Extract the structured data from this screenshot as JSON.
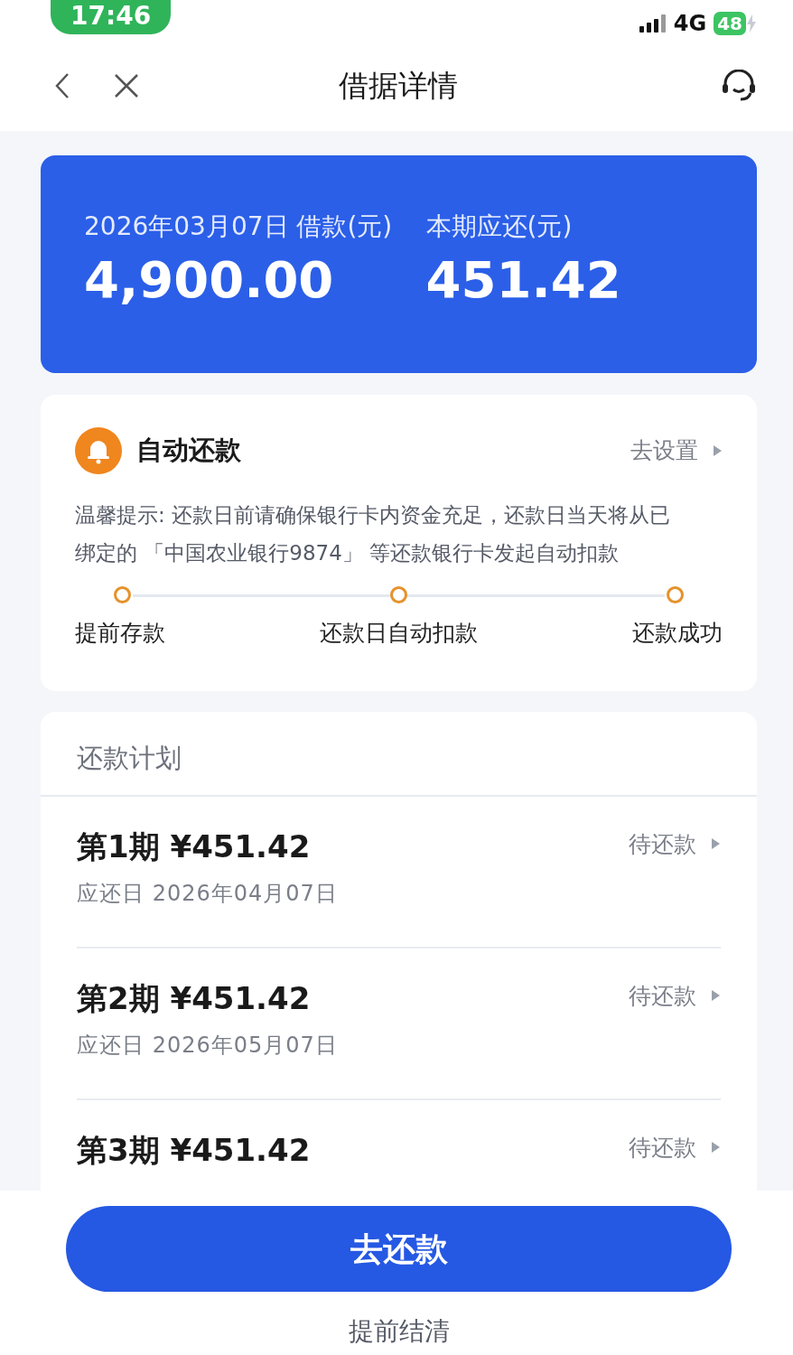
{
  "status_bar": {
    "time": "17:46",
    "network": "4G",
    "battery": "48"
  },
  "header": {
    "title": "借据详情"
  },
  "summary": {
    "loan_label": "2026年03月07日 借款(元)",
    "loan_amount": "4,900.00",
    "due_label": "本期应还(元)",
    "due_amount": "451.42"
  },
  "auto_repay": {
    "title": "自动还款",
    "action": "去设置",
    "notice": "温馨提示: 还款日前请确保银行卡内资金充足，还款日当天将从已绑定的 「中国农业银行9874」 等还款银行卡发起自动扣款",
    "steps": [
      "提前存款",
      "还款日自动扣款",
      "还款成功"
    ]
  },
  "plan": {
    "title": "还款计划",
    "rows": [
      {
        "period": "第1期 ¥451.42",
        "due": "应还日 2026年04月07日",
        "status": "待还款"
      },
      {
        "period": "第2期 ¥451.42",
        "due": "应还日 2026年05月07日",
        "status": "待还款"
      },
      {
        "period": "第3期 ¥451.42",
        "status": "待还款"
      }
    ]
  },
  "footer": {
    "primary": "去还款",
    "secondary": "提前结清"
  }
}
